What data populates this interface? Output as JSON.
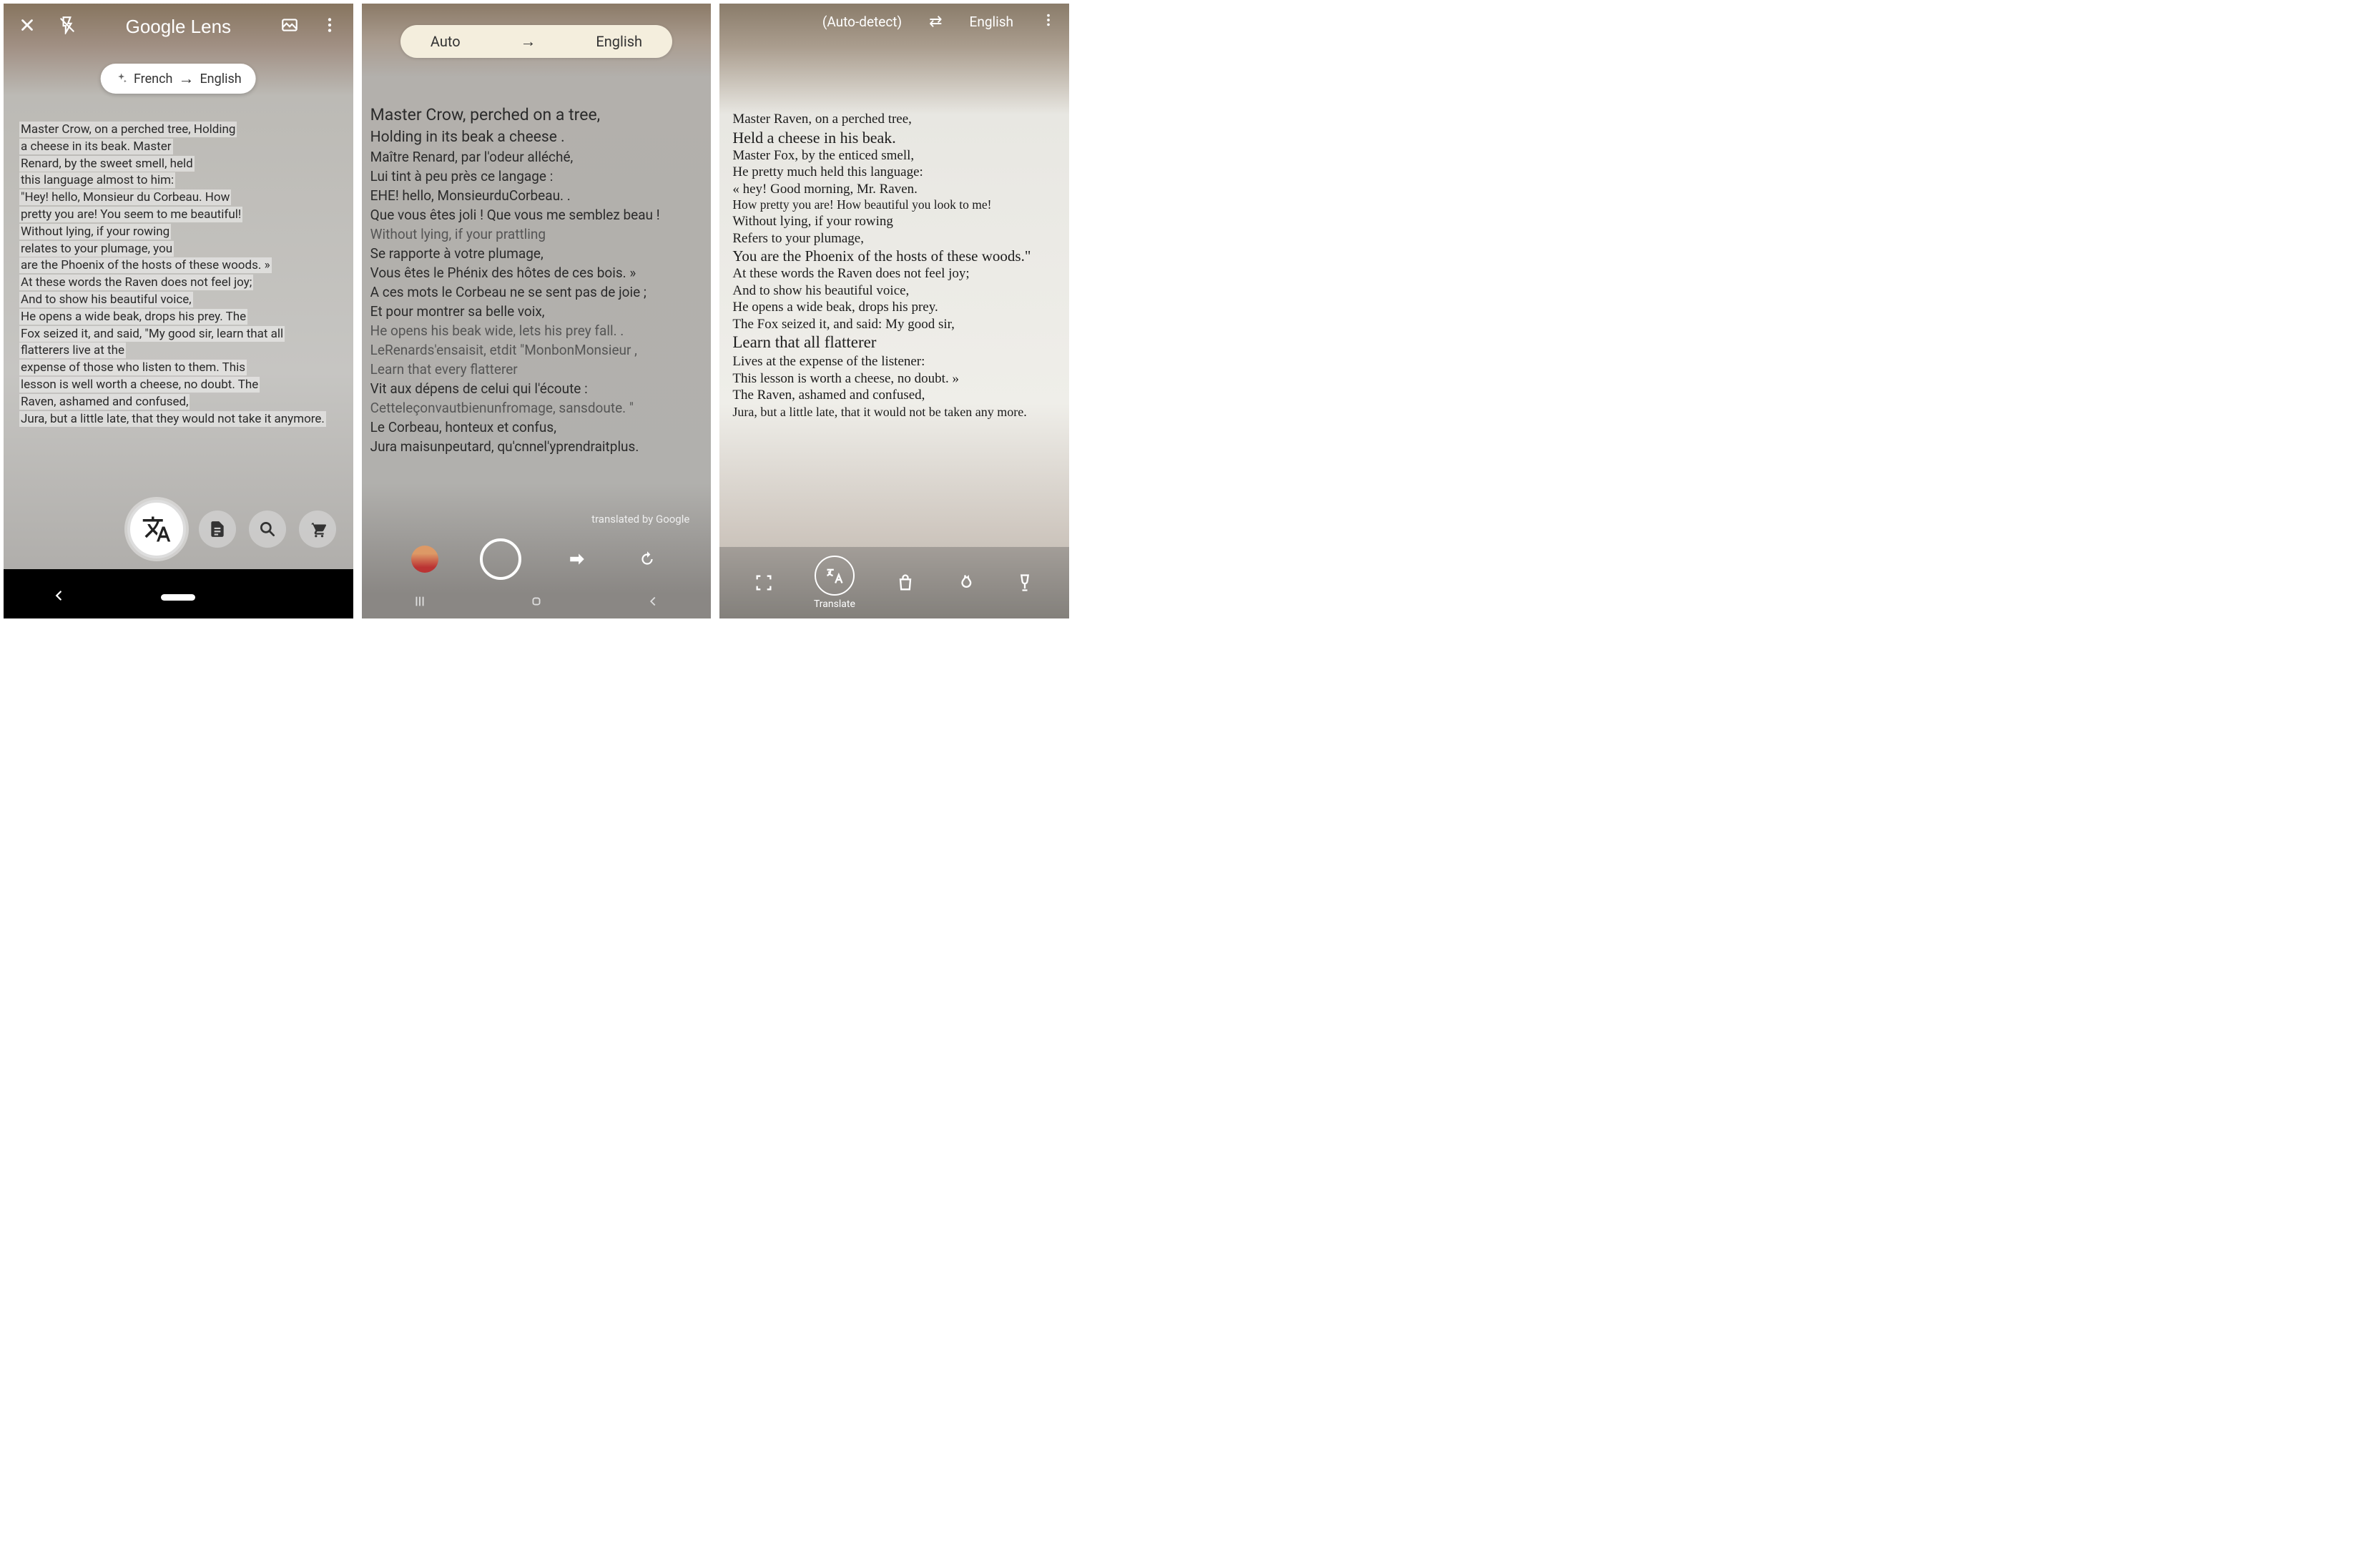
{
  "phone1": {
    "brand": "Google Lens",
    "chip_from": "French",
    "chip_to": "English",
    "lines": [
      "Master Crow, on a perched tree, Holding",
      "a cheese in its beak. Master",
      "Renard, by the sweet smell, held",
      "this language almost to him:",
      "\"Hey! hello, Monsieur du Corbeau. How",
      "pretty you are! You seem to me beautiful!",
      "Without lying, if your rowing",
      "relates to your plumage, you",
      "are the Phoenix of the hosts of these woods. »",
      "At these words the Raven does not feel joy;",
      "And to show his beautiful voice,",
      "He opens a wide beak, drops his prey. The",
      "Fox seized it, and said, \"My good sir, learn that all",
      "flatterers live at the",
      "expense of those who listen to them. This",
      "lesson is well worth a cheese, no doubt. The",
      "Raven, ashamed and confused,",
      "Jura, but a little late, that they would not take it anymore."
    ]
  },
  "phone2": {
    "lang_from": "Auto",
    "lang_to": "English",
    "attribution": "translated by Google",
    "lines": [
      "Master Crow, perched on a tree,",
      "Holding in its beak a cheese .",
      "Maître Renard, par l'odeur alléché,",
      "Lui tint à peu près ce langage :",
      "EHE! hello, MonsieurduCorbeau. .",
      "Que vous êtes joli ! Que vous me semblez beau !",
      "Without lying, if your prattling",
      "Se rapporte à votre plumage,",
      "Vous êtes le Phénix des hôtes de ces bois. »",
      "A ces mots le Corbeau ne se sent pas de joie ;",
      "Et pour montrer sa belle voix,",
      "He opens his beak wide, lets his prey fall. .",
      "LeRenards'ensaisit, etdit \"MonbonMonsieur ,",
      "Learn that every flatterer",
      "Vit aux dépens de celui qui l'écoute :",
      "Cetteleçonvautbienunfromage, sansdoute. \"",
      "Le Corbeau, honteux et confus,",
      "Jura maisunpeutard, qu'cnnel'yprendraitplus."
    ]
  },
  "phone3": {
    "lang_from": "(Auto-detect)",
    "lang_to": "English",
    "translate_label": "Translate",
    "lines": [
      "Master Raven, on a perched tree,",
      "Held a cheese in his beak.",
      "Master Fox, by the enticed smell,",
      "He pretty much held this language:",
      "« hey! Good morning, Mr. Raven.",
      "How pretty you are! How beautiful you look to me!",
      "Without lying, if your rowing",
      "Refers to your plumage,",
      "You are the Phoenix of the hosts of these woods.\"",
      "At these words the Raven does not feel joy;",
      "And to show his beautiful voice,",
      "He opens a wide beak, drops his prey.",
      "The Fox seized it, and said: My good sir,",
      "Learn that all flatterer",
      "Lives at the expense of the listener:",
      "This lesson is worth a cheese, no doubt. »",
      "The Raven, ashamed and confused,",
      "Jura, but a little late, that it would not be taken any more."
    ]
  }
}
